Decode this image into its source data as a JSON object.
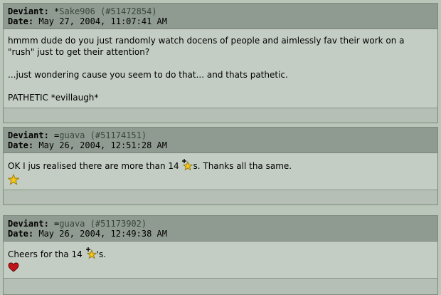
{
  "comments": [
    {
      "deviant_label": "Deviant:",
      "symbol": "*",
      "username": "Sake906",
      "comment_id": "(#51472854)",
      "date_label": "Date:",
      "date": "May 27, 2004, 11:07:41 AM",
      "lines": [
        "hmmm dude do you just randomly watch docens of people and aimlessly fav their work on a",
        "\"rush\" just to get their attention?",
        "...just wondering cause you seem to do that... and thats pathetic.",
        "PATHETIC *evillaugh*"
      ]
    },
    {
      "deviant_label": "Deviant:",
      "symbol": "=",
      "username": "guava",
      "comment_id": "(#51174151)",
      "date_label": "Date:",
      "date": "May 26, 2004, 12:51:28 AM",
      "text_before": "OK I jus realised there are more than 14 ",
      "text_after": "s. Thanks all tha same.",
      "icons": [
        "star-plus-icon",
        "star-emoticon-icon"
      ]
    },
    {
      "deviant_label": "Deviant:",
      "symbol": "=",
      "username": "guava",
      "comment_id": "(#51173902)",
      "date_label": "Date:",
      "date": "May 26, 2004, 12:49:38 AM",
      "text_before": "Cheers for tha 14 ",
      "text_after": "'s.",
      "icons": [
        "star-plus-icon",
        "heart-emoticon-icon"
      ]
    }
  ],
  "colors": {
    "page_bg": "#bbc6bb",
    "header_bg": "#8f9a90",
    "body_bg": "#c4cdc4",
    "link": "#39473b",
    "star": "#f4c81a",
    "heart": "#c0141a"
  }
}
